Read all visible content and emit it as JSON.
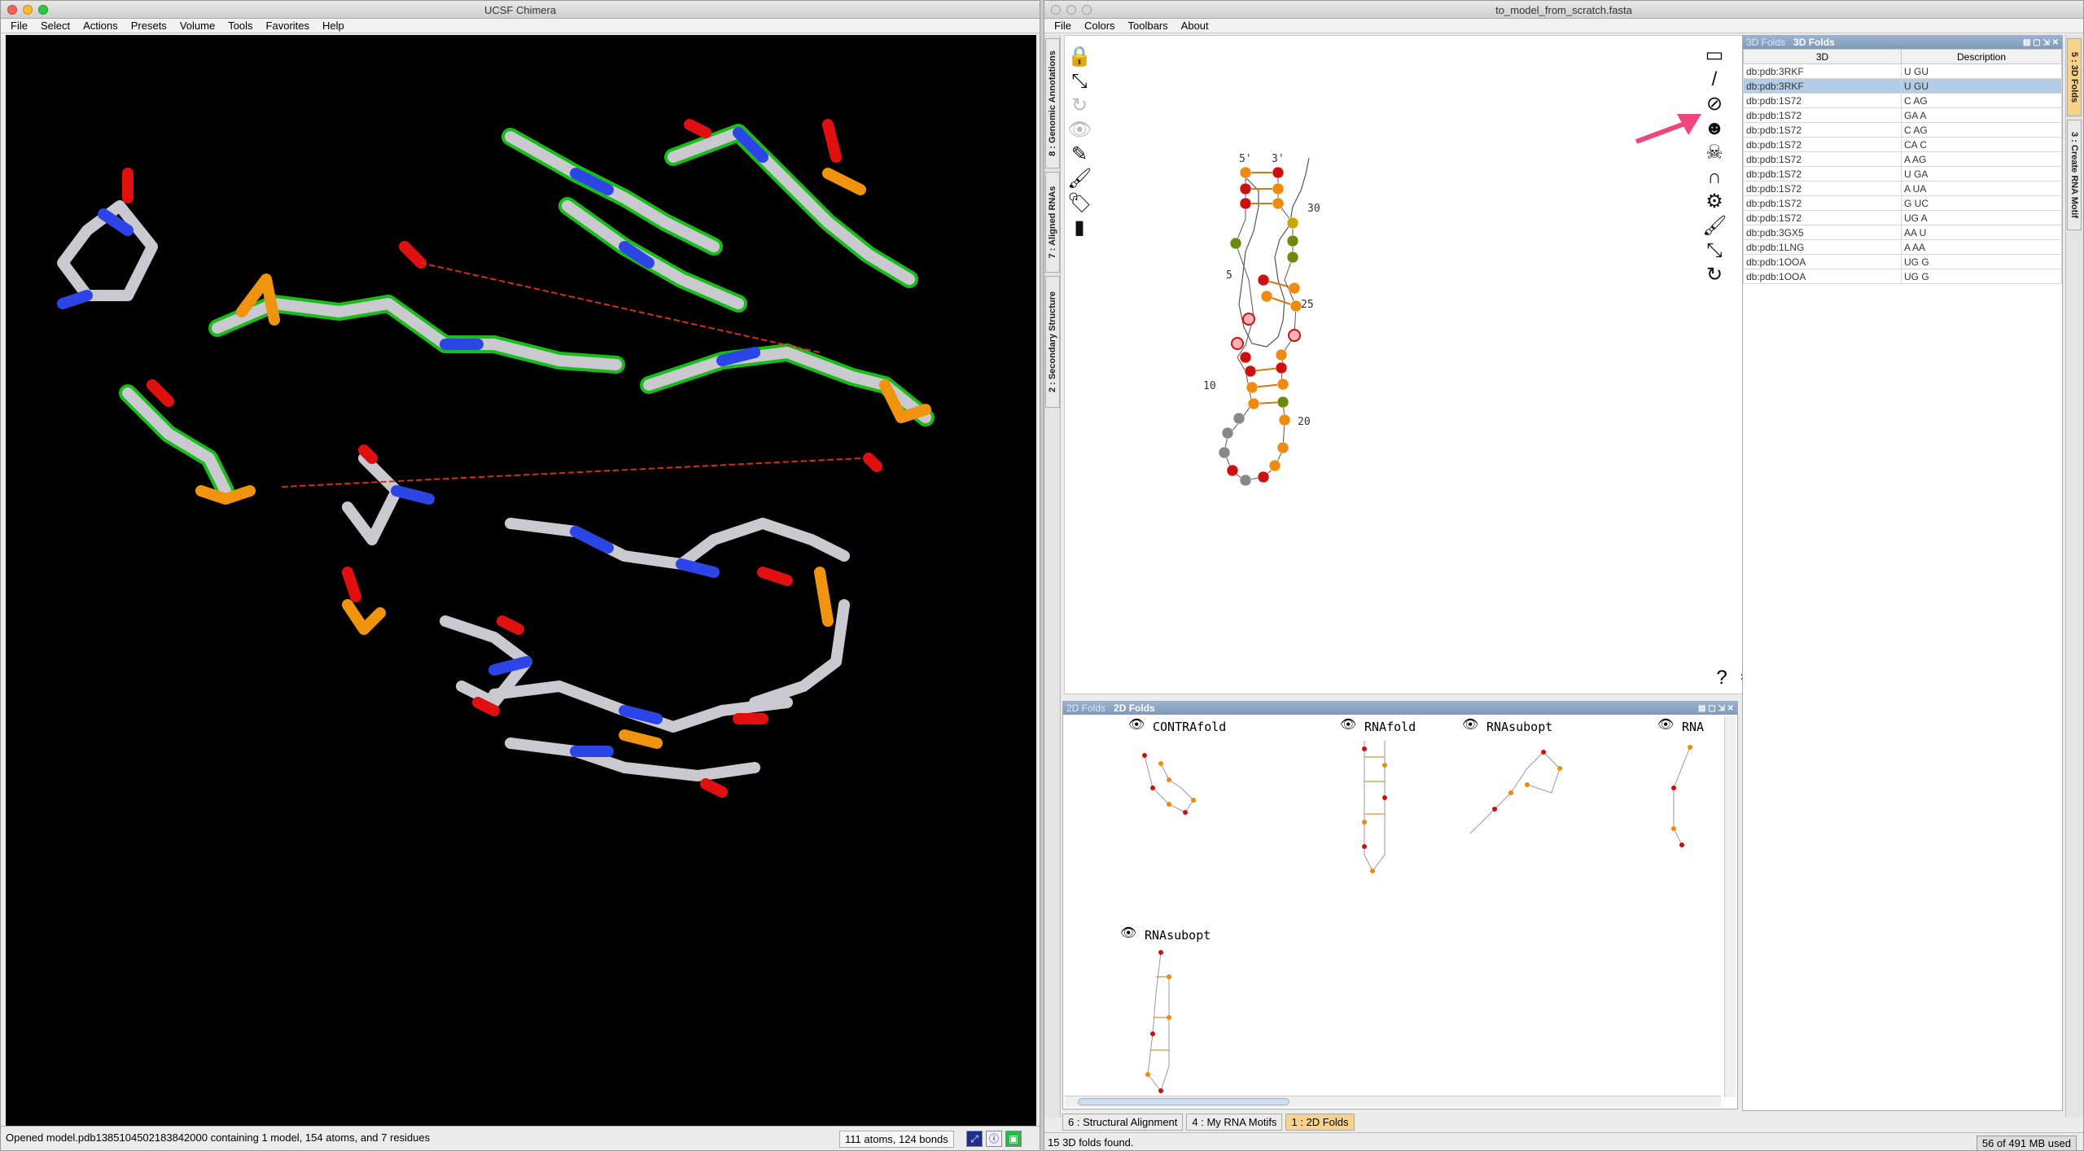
{
  "chimera": {
    "title": "UCSF Chimera",
    "menu": [
      "File",
      "Select",
      "Actions",
      "Presets",
      "Volume",
      "Tools",
      "Favorites",
      "Help"
    ],
    "status_message": "Opened model.pdb13851045021838420​00 containing 1 model, 154 atoms, and 7 residues",
    "counts": "111 atoms, 124 bonds"
  },
  "s2s": {
    "title": "to_model_from_scratch.fasta",
    "menu": [
      "File",
      "Colors",
      "Toolbars",
      "About"
    ],
    "left_tabs": [
      "8 : Genomic Annotations",
      "7 : Aligned RNAs",
      "2 : Secondary Structure"
    ],
    "right_tabs": [
      "5 : 3D Folds",
      "3 : Create RNA Motif"
    ],
    "panel_3d": {
      "ghost_title": "3D Folds",
      "title": "3D Folds",
      "col_3d": "3D",
      "col_desc": "Description",
      "rows": [
        {
          "id": "db:pdb:3RKF",
          "desc": "U GU"
        },
        {
          "id": "db:pdb:3RKF",
          "desc": "U GU"
        },
        {
          "id": "db:pdb:1S72",
          "desc": "C AG"
        },
        {
          "id": "db:pdb:1S72",
          "desc": "GA A"
        },
        {
          "id": "db:pdb:1S72",
          "desc": "C AG"
        },
        {
          "id": "db:pdb:1S72",
          "desc": "CA C"
        },
        {
          "id": "db:pdb:1S72",
          "desc": "A AG"
        },
        {
          "id": "db:pdb:1S72",
          "desc": "U GA"
        },
        {
          "id": "db:pdb:1S72",
          "desc": "A UA"
        },
        {
          "id": "db:pdb:1S72",
          "desc": "G UC"
        },
        {
          "id": "db:pdb:1S72",
          "desc": "UG A"
        },
        {
          "id": "db:pdb:3GX5",
          "desc": "AA U"
        },
        {
          "id": "db:pdb:1LNG",
          "desc": "A AA"
        },
        {
          "id": "db:pdb:1OOA",
          "desc": "UG G"
        },
        {
          "id": "db:pdb:1OOA",
          "desc": "UG G"
        }
      ]
    },
    "panel_2d": {
      "ghost_title": "2D Folds",
      "title": "2D Folds",
      "folds": [
        "CONTRAfold",
        "RNAfold",
        "RNAsubopt",
        "RNA",
        "RNAsubopt"
      ]
    },
    "structure_labels": {
      "five": "5'",
      "three": "3'",
      "n5": "5",
      "n10": "10",
      "n20": "20",
      "n25": "25",
      "n30": "30"
    },
    "bottom_tabs": [
      "6 : Structural Alignment",
      "4 : My RNA Motifs",
      "1 : 2D Folds"
    ],
    "status_left": "15 3D folds found.",
    "memory": "56 of 491 MB used",
    "colors": {
      "accent_tab": "#f6d28a",
      "selection": "#b4cde6",
      "arrow": "#f0457a"
    }
  }
}
